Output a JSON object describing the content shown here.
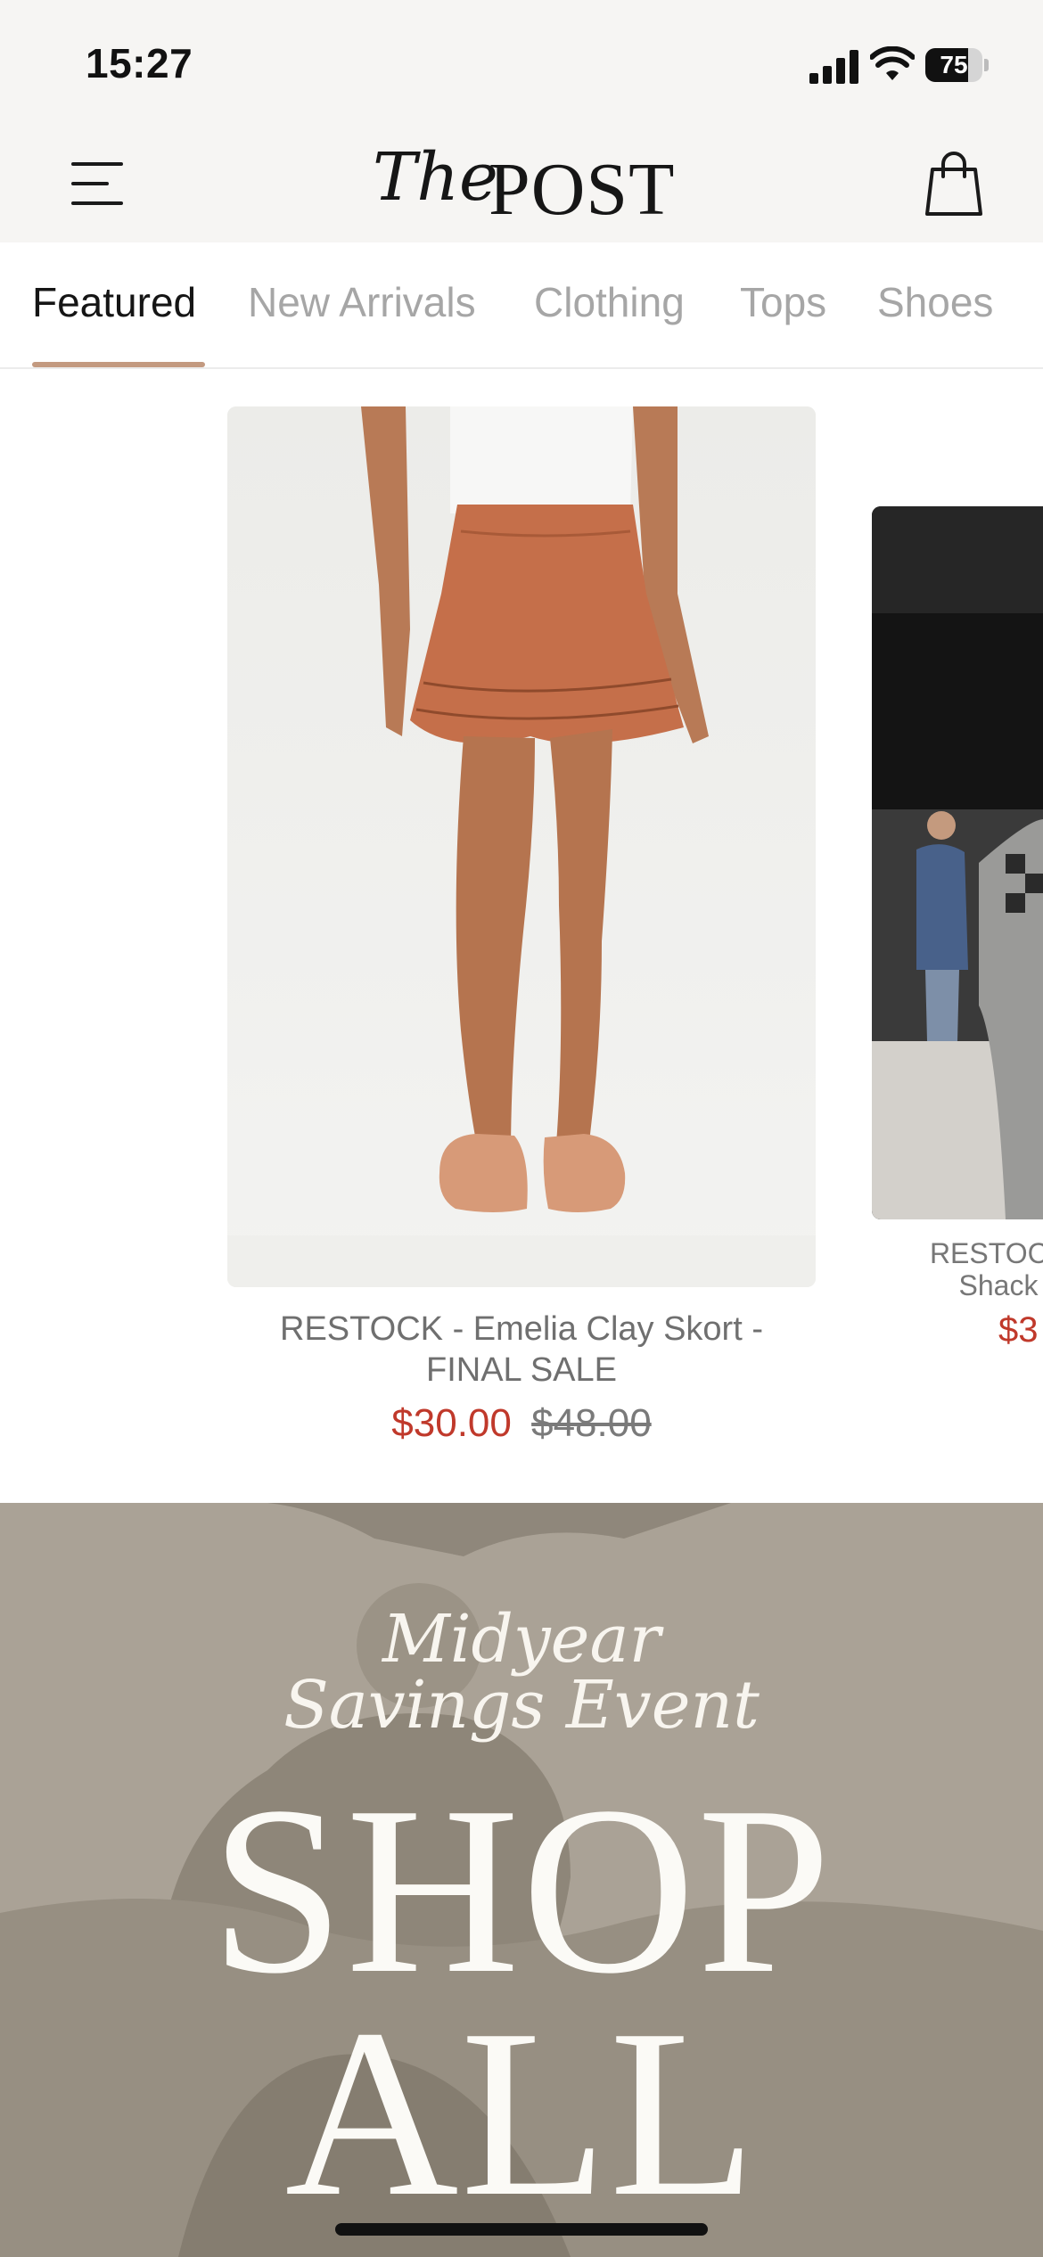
{
  "status_bar": {
    "time": "15:27",
    "battery_percent": "75",
    "battery_level": 0.75
  },
  "header": {
    "logo_script": "The",
    "logo_text": "POST",
    "menu_icon": "hamburger-menu-icon",
    "cart_icon": "shopping-bag-icon"
  },
  "tabs": [
    {
      "label": "Featured",
      "active": true
    },
    {
      "label": "New Arrivals",
      "active": false
    },
    {
      "label": "Clothing",
      "active": false
    },
    {
      "label": "Tops",
      "active": false
    },
    {
      "label": "Shoes",
      "active": false
    }
  ],
  "products": [
    {
      "name_line1": "RESTOCK - Emelia Clay Skort -",
      "name_line2": "FINAL SALE",
      "sale_price": "$30.00",
      "original_price": "$48.00"
    },
    {
      "name_line1": "RESTOCK",
      "name_line2": "Shack",
      "sale_price": "$3"
    }
  ],
  "banner": {
    "script_line1": "Midyear",
    "script_line2": "Savings Event",
    "headline_line1": "SHOP",
    "headline_line2": "ALL"
  },
  "colors": {
    "accent_underline": "#c39a80",
    "sale_price": "#c0392b",
    "header_bg": "#f6f5f3",
    "banner_bg": "#a9a194"
  }
}
